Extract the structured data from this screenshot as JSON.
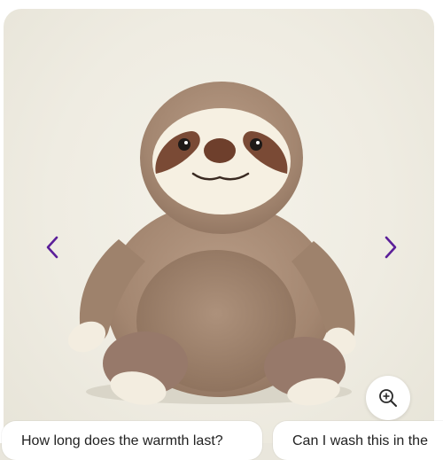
{
  "colors": {
    "accent": "#5b1f99",
    "fur": "#a88a74",
    "face": "#f6f0e2",
    "mask": "#7a4a35"
  },
  "gallery": {
    "image_alt": "plush sloth toy",
    "prev_icon": "chevron-left-icon",
    "next_icon": "chevron-right-icon",
    "zoom_icon": "zoom-in-icon"
  },
  "questions": [
    {
      "label": "How long does the warmth last?"
    },
    {
      "label": "Can I wash this in the"
    }
  ]
}
